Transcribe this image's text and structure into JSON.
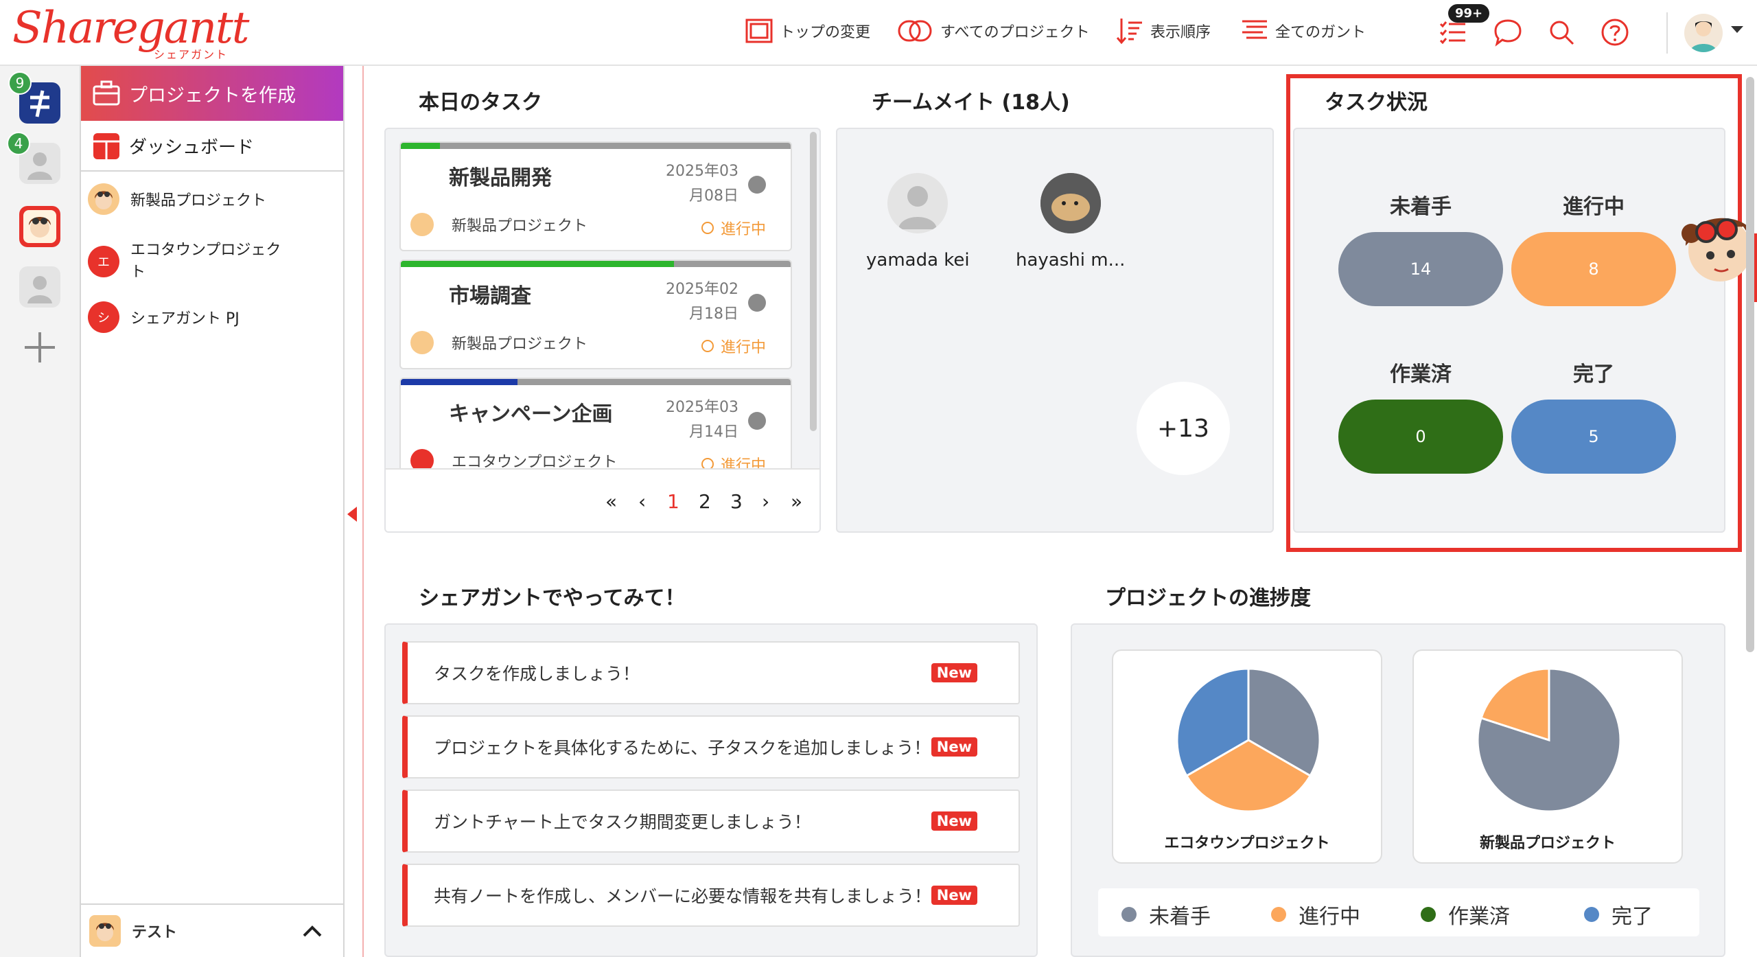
{
  "app": {
    "logo_text": "Sharegantt",
    "logo_sub": "シェアガント"
  },
  "topnav": {
    "items": [
      {
        "label": "トップの変更",
        "icon": "monitor-icon"
      },
      {
        "label": "すべてのプロジェクト",
        "icon": "overlap-circles-icon"
      },
      {
        "label": "表示順序",
        "icon": "sort-order-icon"
      },
      {
        "label": "全てのガント",
        "icon": "gantt-list-icon"
      }
    ],
    "notification_badge": "99+"
  },
  "rail": {
    "badges": [
      "9",
      "4"
    ]
  },
  "sidebar": {
    "create_label": "プロジェクトを作成",
    "dashboard_label": "ダッシュボード",
    "projects": [
      {
        "label": "新製品プロジェクト",
        "avatar": "mascot"
      },
      {
        "label": "エコタウンプロジェクト",
        "avatar": "エ",
        "color": "#e8322b"
      },
      {
        "label": "シェアガント PJ",
        "avatar": "シ",
        "color": "#e8322b"
      }
    ],
    "bottom_label": "テスト"
  },
  "today_tasks": {
    "title": "本日のタスク",
    "tasks": [
      {
        "title": "新製品開発",
        "date_line1": "2025年03",
        "date_line2": "月08日",
        "project": "新製品プロジェクト",
        "status": "進行中",
        "progress": 0.1,
        "bar_color": "#2db52d"
      },
      {
        "title": "市場調査",
        "date_line1": "2025年02",
        "date_line2": "月18日",
        "project": "新製品プロジェクト",
        "status": "進行中",
        "progress": 0.7,
        "bar_color": "#2db52d"
      },
      {
        "title": "キャンペーン企画",
        "date_line1": "2025年03",
        "date_line2": "月14日",
        "project": "エコタウンプロジェクト",
        "status": "進行中",
        "progress": 0.3,
        "bar_color": "#1c3aa8"
      }
    ],
    "pager": {
      "first": "«",
      "prev": "‹",
      "pages": [
        "1",
        "2",
        "3"
      ],
      "next": "›",
      "last": "»"
    }
  },
  "teammates": {
    "title": "チームメイト (18人)",
    "members": [
      {
        "name": "yamada kei"
      },
      {
        "name": "hayashi m..."
      }
    ],
    "more_label": "+13"
  },
  "task_status": {
    "title": "タスク状況",
    "items": [
      {
        "label": "未着手",
        "count": "14",
        "color": "#7f8a9c"
      },
      {
        "label": "進行中",
        "count": "8",
        "color": "#fca75c"
      },
      {
        "label": "作業済",
        "count": "0",
        "color": "#2f6e17"
      },
      {
        "label": "完了",
        "count": "5",
        "color": "#5588c6"
      }
    ]
  },
  "try_it": {
    "title": "シェアガントでやってみて！",
    "hints": [
      {
        "text": "タスクを作成しましょう！",
        "badge": "New"
      },
      {
        "text": "プロジェクトを具体化するために、子タスクを追加しましょう！",
        "badge": "New"
      },
      {
        "text": "ガントチャート上でタスク期間変更しましょう！",
        "badge": "New"
      },
      {
        "text": "共有ノートを作成し、メンバーに必要な情報を共有しましょう！",
        "badge": "New"
      }
    ]
  },
  "progress": {
    "title": "プロジェクトの進捗度",
    "legend": [
      {
        "label": "未着手",
        "color": "#7f8a9c"
      },
      {
        "label": "進行中",
        "color": "#fca75c"
      },
      {
        "label": "作業済",
        "color": "#2f6e17"
      },
      {
        "label": "完了",
        "color": "#5588c6"
      }
    ]
  },
  "chart_data": [
    {
      "type": "pie",
      "title": "エコタウンプロジェクト",
      "categories": [
        "未着手",
        "進行中",
        "作業済",
        "完了"
      ],
      "values": [
        1,
        1,
        0,
        1
      ],
      "colors": [
        "#7f8a9c",
        "#fca75c",
        "#2f6e17",
        "#5588c6"
      ]
    },
    {
      "type": "pie",
      "title": "新製品プロジェクト",
      "categories": [
        "未着手",
        "進行中",
        "作業済",
        "完了"
      ],
      "values": [
        4,
        1,
        0,
        0
      ],
      "colors": [
        "#7f8a9c",
        "#fca75c",
        "#2f6e17",
        "#5588c6"
      ]
    }
  ]
}
